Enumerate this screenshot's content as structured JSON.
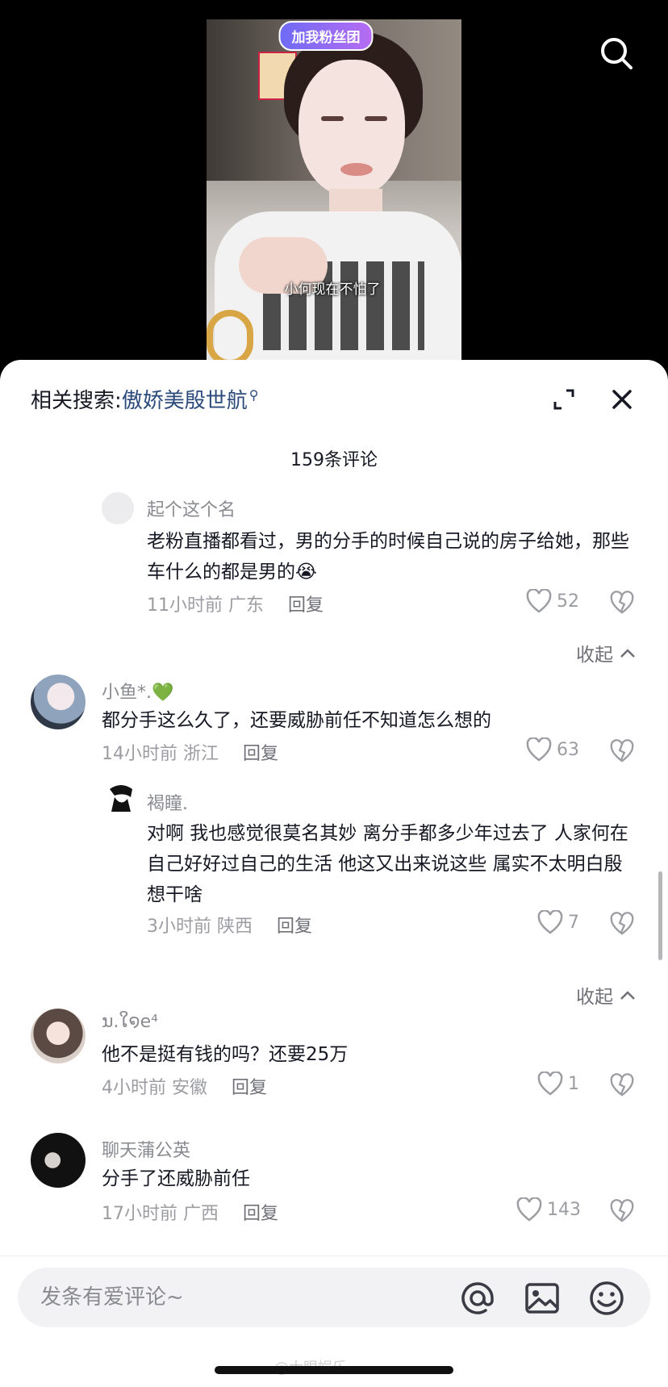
{
  "video": {
    "fan_badge": "加我粉丝团",
    "caption": "小何现在不怕了",
    "search_icon": "search-icon"
  },
  "sheet": {
    "related_label": "相关搜索:",
    "related_keyword": "傲娇美殷世航",
    "comment_count": "159条评论"
  },
  "comments": [
    {
      "user": "起个这个名",
      "text": "老粉直播都看过，男的分手的时候自己说的房子给她，那些车什么的都是男的😭",
      "time_loc": "11小时前 广东",
      "reply": "回复",
      "likes": "52",
      "is_reply": true
    },
    {
      "collapse": "收起"
    },
    {
      "user": "小鱼*.💚",
      "text": "都分手这么久了，还要威胁前任不知道怎么想的",
      "time_loc": "14小时前 浙江",
      "reply": "回复",
      "likes": "63",
      "is_reply": false
    },
    {
      "user": "褐瞳.",
      "text": "对啊 我也感觉很莫名其妙 离分手都多少年过去了 人家何在自己好好过自己的生活 他这又出来说这些 属实不太明白殷想干啥",
      "time_loc": "3小时前 陕西",
      "reply": "回复",
      "likes": "7",
      "is_reply": true
    },
    {
      "collapse": "收起"
    },
    {
      "user": "ນ.ໃ໑e⁴",
      "text": "他不是挺有钱的吗？还要25万",
      "time_loc": "4小时前 安徽",
      "reply": "回复",
      "likes": "1",
      "is_reply": false
    },
    {
      "user": "聊天蒲公英",
      "text": "分手了还威胁前任",
      "time_loc": "17小时前 广西",
      "reply": "回复",
      "likes": "143",
      "is_reply": false
    }
  ],
  "input": {
    "placeholder": "发条有爱评论~",
    "watermark": "@大眼娱乐"
  },
  "colors": {
    "accent_link": "#2b4a7a",
    "meta_gray": "#9c9da2",
    "text_main": "#161823"
  }
}
